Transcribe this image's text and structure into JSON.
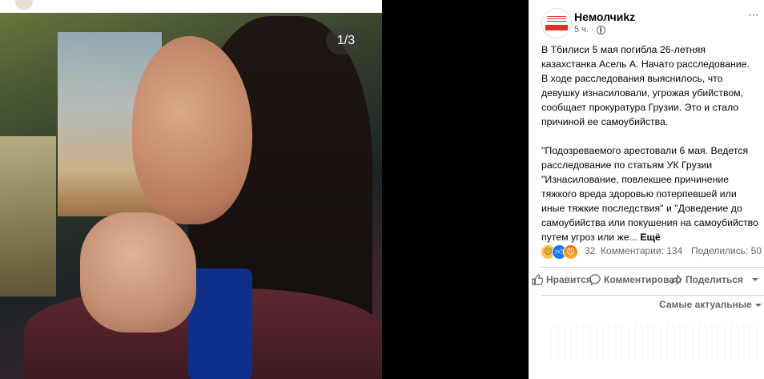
{
  "photo": {
    "counter": "1/3"
  },
  "post": {
    "page_name": "Немолчиkz",
    "time": "5 ч.",
    "paragraphs": [
      [
        "В Тбилиси 5 мая погибла 26-летняя",
        "казахстанка Асель А. Начато расследование.",
        "В ходе расследования выяснилось, что",
        "девушку изнасиловали, угрожая убийством,",
        "сообщает прокуратура Грузии. Это и стало",
        "причиной ее самоубийства."
      ],
      [
        "\"Подозреваемого арестовали 6 мая. Ведется",
        "расследование по статьям УК Грузии",
        "\"Изнасилование, повлекшее причинение",
        "тяжкого вреда здоровью потерпевшей или",
        "иные тяжкие последствия\" и \"Доведение до",
        "самоубийства или покушения на самоубийство",
        "путем угроз или же..."
      ]
    ],
    "more_label": "Ещё"
  },
  "stats": {
    "reactions_count": "32",
    "comments": "Комментарии: 134",
    "shares": "Поделились: 50"
  },
  "actions": {
    "like": "Нравится",
    "comment": "Комментировать",
    "share": "Поделиться"
  },
  "comments": {
    "sort_label": "Самые актуальные"
  },
  "colors": {
    "like_blue": "#1877f2",
    "text_secondary": "#65676b",
    "brand_red": "#d8322b"
  }
}
